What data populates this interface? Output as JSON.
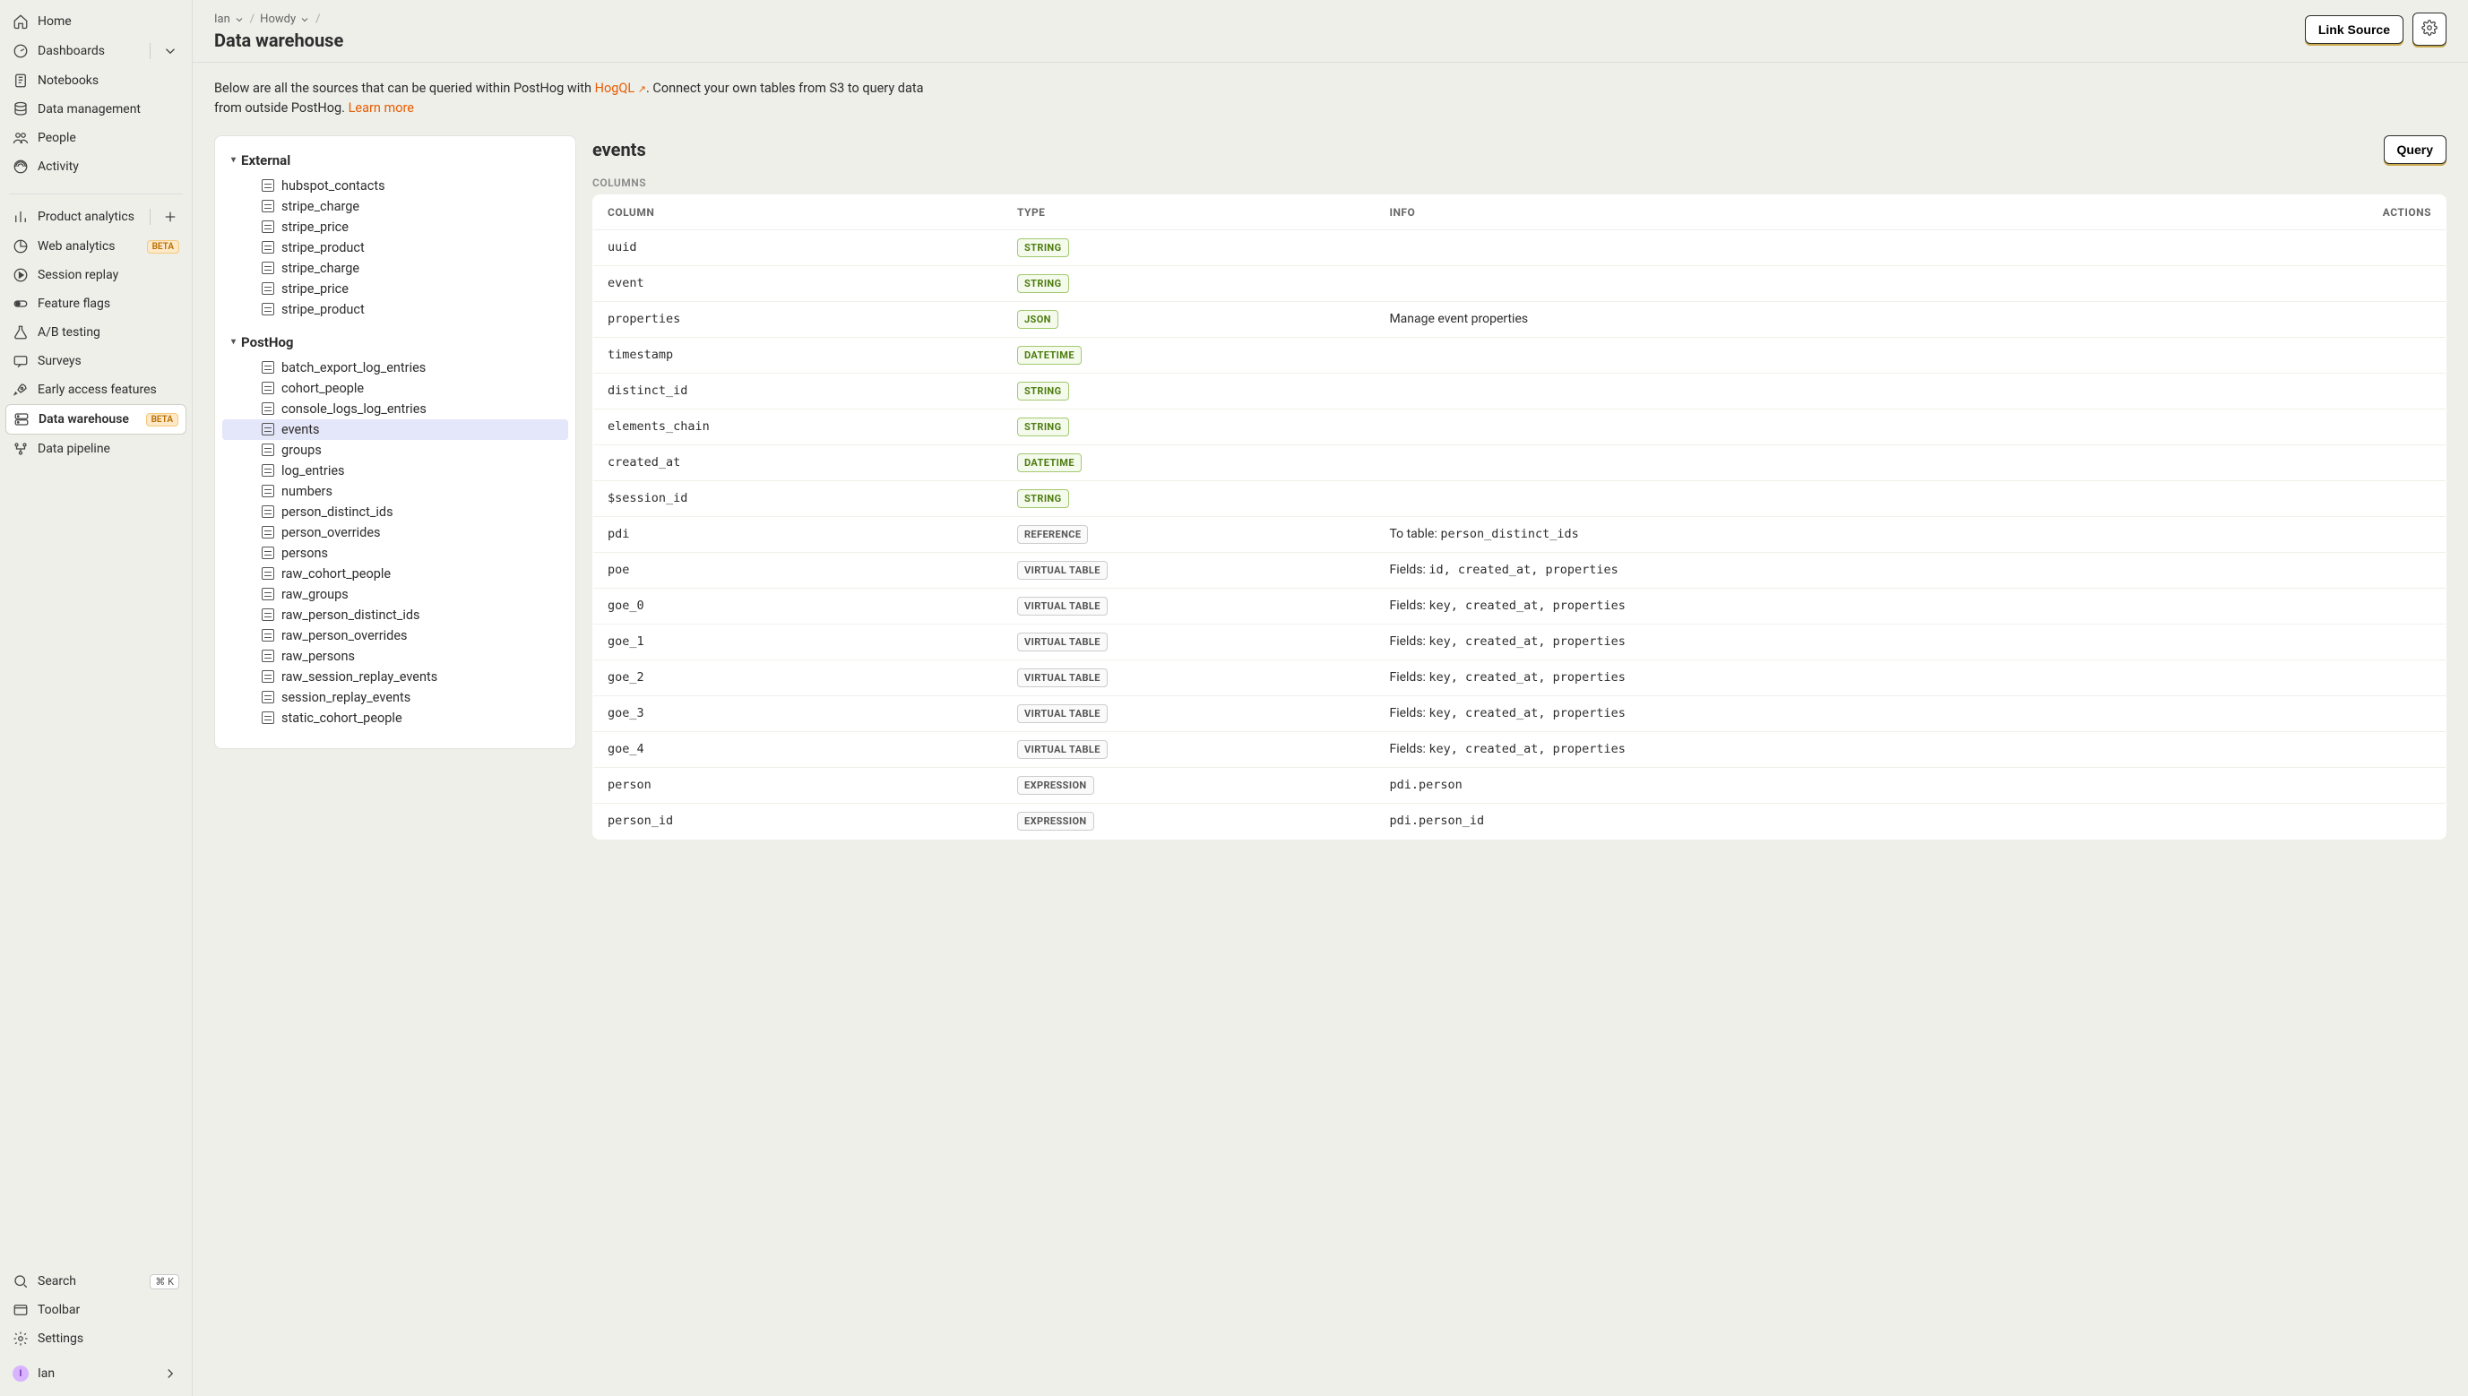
{
  "sidebar": {
    "primary": [
      {
        "label": "Home",
        "icon": "home-icon"
      },
      {
        "label": "Dashboards",
        "icon": "gauge-icon",
        "trailing": "chevron"
      },
      {
        "label": "Notebooks",
        "icon": "notebook-icon"
      },
      {
        "label": "Data management",
        "icon": "database-icon"
      },
      {
        "label": "People",
        "icon": "people-icon"
      },
      {
        "label": "Activity",
        "icon": "activity-icon"
      }
    ],
    "tools": [
      {
        "label": "Product analytics",
        "icon": "bar-icon",
        "trailing": "plus"
      },
      {
        "label": "Web analytics",
        "icon": "pie-icon",
        "chip": "BETA"
      },
      {
        "label": "Session replay",
        "icon": "play-icon"
      },
      {
        "label": "Feature flags",
        "icon": "toggle-icon"
      },
      {
        "label": "A/B testing",
        "icon": "flask-icon"
      },
      {
        "label": "Surveys",
        "icon": "message-icon"
      },
      {
        "label": "Early access features",
        "icon": "rocket-icon"
      },
      {
        "label": "Data warehouse",
        "icon": "server-icon",
        "chip": "BETA",
        "active": true
      },
      {
        "label": "Data pipeline",
        "icon": "pipeline-icon"
      }
    ],
    "bottom": [
      {
        "label": "Search",
        "icon": "search-icon",
        "kbd": "⌘ K"
      },
      {
        "label": "Toolbar",
        "icon": "toolbar-icon"
      },
      {
        "label": "Settings",
        "icon": "gear-icon"
      }
    ],
    "user": {
      "label": "Ian",
      "initial": "I"
    }
  },
  "header": {
    "breadcrumbs": [
      {
        "label": "Ian"
      },
      {
        "label": "Howdy"
      }
    ],
    "title": "Data warehouse",
    "link_source": "Link Source"
  },
  "intro": {
    "part1": "Below are all the sources that can be queried within PostHog with ",
    "hogql": "HogQL",
    "part2": ". Connect your own tables from S3 to query data from outside PostHog. ",
    "learn": "Learn more"
  },
  "tree": {
    "groups": [
      {
        "name": "External",
        "items": [
          "hubspot_contacts",
          "stripe_charge",
          "stripe_price",
          "stripe_product",
          "stripe_charge",
          "stripe_price",
          "stripe_product"
        ]
      },
      {
        "name": "PostHog",
        "items": [
          "batch_export_log_entries",
          "cohort_people",
          "console_logs_log_entries",
          "events",
          "groups",
          "log_entries",
          "numbers",
          "person_distinct_ids",
          "person_overrides",
          "persons",
          "raw_cohort_people",
          "raw_groups",
          "raw_person_distinct_ids",
          "raw_person_overrides",
          "raw_persons",
          "raw_session_replay_events",
          "session_replay_events",
          "static_cohort_people"
        ],
        "selected": "events"
      }
    ]
  },
  "detail": {
    "title": "events",
    "query_btn": "Query",
    "columns_label": "COLUMNS",
    "headers": {
      "column": "COLUMN",
      "type": "TYPE",
      "info": "INFO",
      "actions": "ACTIONS"
    },
    "rows": [
      {
        "column": "uuid",
        "type": "STRING",
        "info": ""
      },
      {
        "column": "event",
        "type": "STRING",
        "info": ""
      },
      {
        "column": "properties",
        "type": "JSON",
        "info": "Manage event properties"
      },
      {
        "column": "timestamp",
        "type": "DATETIME",
        "info": ""
      },
      {
        "column": "distinct_id",
        "type": "STRING",
        "info": ""
      },
      {
        "column": "elements_chain",
        "type": "STRING",
        "info": ""
      },
      {
        "column": "created_at",
        "type": "DATETIME",
        "info": ""
      },
      {
        "column": "$session_id",
        "type": "STRING",
        "info": ""
      },
      {
        "column": "pdi",
        "type": "REFERENCE",
        "info_prefix": "To table: ",
        "info_mono": "person_distinct_ids"
      },
      {
        "column": "poe",
        "type": "VIRTUAL TABLE",
        "info_prefix": "Fields: ",
        "info_mono": "id, created_at, properties"
      },
      {
        "column": "goe_0",
        "type": "VIRTUAL TABLE",
        "info_prefix": "Fields: ",
        "info_mono": "key, created_at, properties"
      },
      {
        "column": "goe_1",
        "type": "VIRTUAL TABLE",
        "info_prefix": "Fields: ",
        "info_mono": "key, created_at, properties"
      },
      {
        "column": "goe_2",
        "type": "VIRTUAL TABLE",
        "info_prefix": "Fields: ",
        "info_mono": "key, created_at, properties"
      },
      {
        "column": "goe_3",
        "type": "VIRTUAL TABLE",
        "info_prefix": "Fields: ",
        "info_mono": "key, created_at, properties"
      },
      {
        "column": "goe_4",
        "type": "VIRTUAL TABLE",
        "info_prefix": "Fields: ",
        "info_mono": "key, created_at, properties"
      },
      {
        "column": "person",
        "type": "EXPRESSION",
        "info_mono": "pdi.person"
      },
      {
        "column": "person_id",
        "type": "EXPRESSION",
        "info_mono": "pdi.person_id"
      }
    ]
  }
}
